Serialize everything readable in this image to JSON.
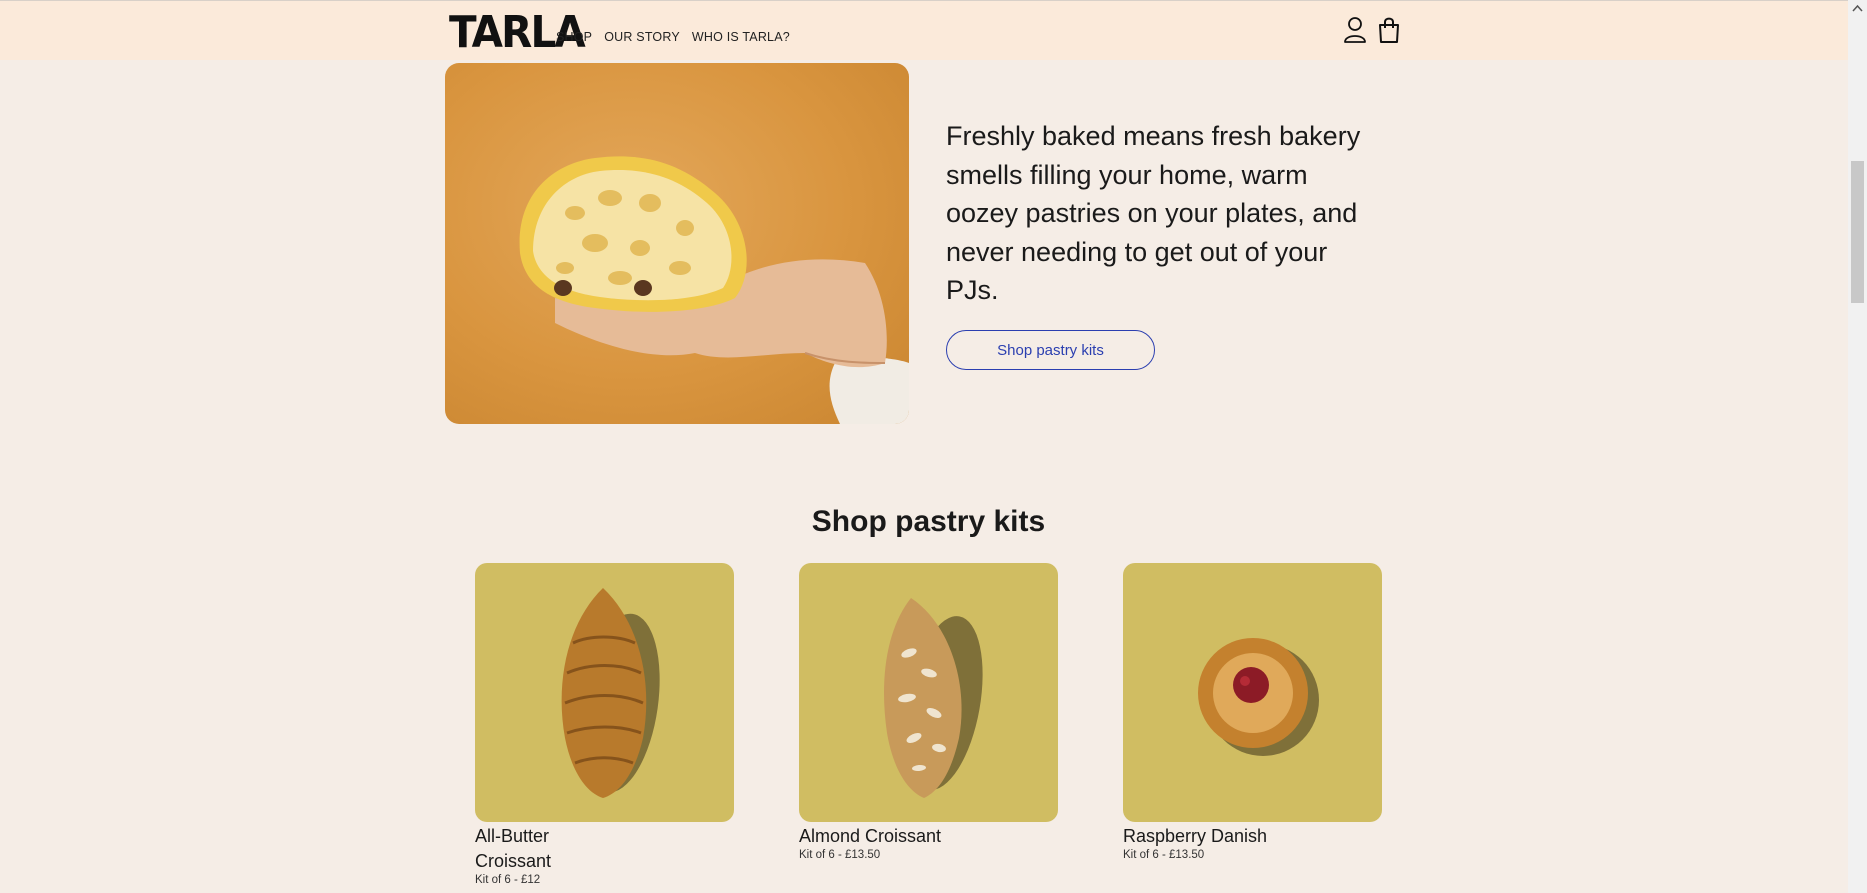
{
  "header": {
    "logo": "TARLA",
    "nav": [
      "SHOP",
      "OUR STORY",
      "WHO IS TARLA?"
    ],
    "icons": [
      "account-icon",
      "shopping-bag-icon"
    ]
  },
  "hero": {
    "text": "Freshly baked means fresh bakery smells filling your home, warm oozey pastries on your plates, and never needing to get out of your PJs.",
    "button": "Shop pastry kits"
  },
  "shop": {
    "title": "Shop pastry kits",
    "products": [
      {
        "name": "All-Butter Croissant",
        "price": "Kit of 6 - £12"
      },
      {
        "name": "Almond Croissant",
        "price": "Kit of 6 - £13.50"
      },
      {
        "name": "Raspberry Danish",
        "price": "Kit of 6 - £13.50"
      }
    ]
  },
  "colors": {
    "page_bg": "#f5ede6",
    "header_bg": "#fbeada",
    "accent": "#2b3fb0",
    "product_bg": "#d0bd62"
  }
}
